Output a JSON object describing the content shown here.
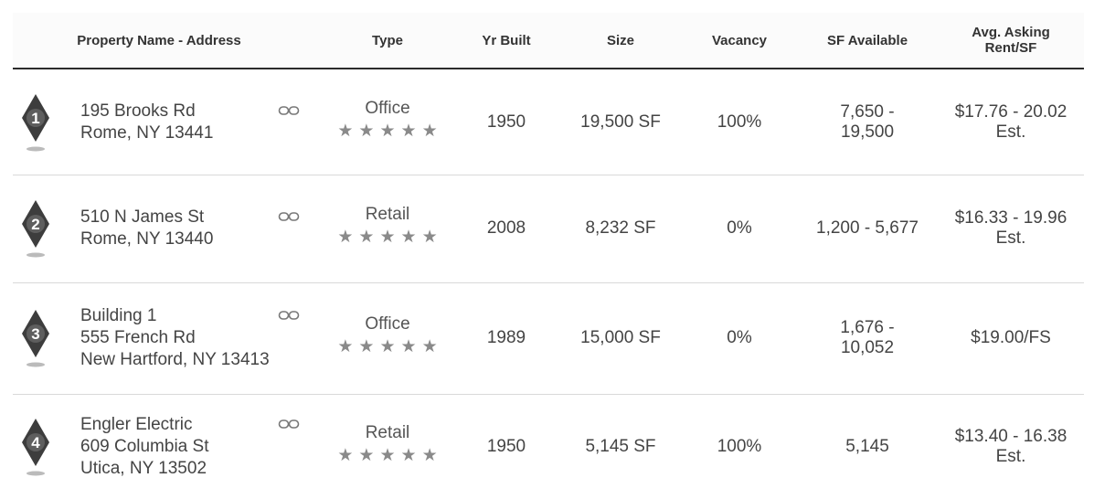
{
  "header": {
    "property": "Property Name - Address",
    "type": "Type",
    "yr_built": "Yr Built",
    "size": "Size",
    "vacancy": "Vacancy",
    "sf_available": "SF Available",
    "rent_line1": "Avg. Asking",
    "rent_line2": "Rent/SF"
  },
  "rows": [
    {
      "num": "1",
      "addr_lines": [
        "195 Brooks Rd",
        "Rome, NY 13441",
        ""
      ],
      "type": "Office",
      "stars": [
        "★",
        "★",
        "★",
        "★",
        "★"
      ],
      "yr_built": "1950",
      "size": "19,500 SF",
      "vacancy": "100%",
      "sf_available_1": "7,650 -",
      "sf_available_2": "19,500",
      "rent_1": "$17.76 - 20.02",
      "rent_2": "Est."
    },
    {
      "num": "2",
      "addr_lines": [
        "510 N James St",
        "Rome, NY 13440",
        ""
      ],
      "type": "Retail",
      "stars": [
        "★",
        "★",
        "★",
        "★",
        "★"
      ],
      "yr_built": "2008",
      "size": "8,232 SF",
      "vacancy": "0%",
      "sf_available_1": "1,200 - 5,677",
      "sf_available_2": "",
      "rent_1": "$16.33 - 19.96",
      "rent_2": "Est."
    },
    {
      "num": "3",
      "addr_lines": [
        "Building 1",
        "555 French Rd",
        "New Hartford, NY 13413"
      ],
      "type": "Office",
      "stars": [
        "★",
        "★",
        "★",
        "★",
        "★"
      ],
      "yr_built": "1989",
      "size": "15,000 SF",
      "vacancy": "0%",
      "sf_available_1": "1,676 -",
      "sf_available_2": "10,052",
      "rent_1": "$19.00/FS",
      "rent_2": ""
    },
    {
      "num": "4",
      "addr_lines": [
        "Engler Electric",
        "609 Columbia St",
        "Utica, NY 13502"
      ],
      "type": "Retail",
      "stars": [
        "★",
        "★",
        "★",
        "★",
        "★"
      ],
      "yr_built": "1950",
      "size": "5,145 SF",
      "vacancy": "100%",
      "sf_available_1": "5,145",
      "sf_available_2": "",
      "rent_1": "$13.40 - 16.38",
      "rent_2": "Est."
    }
  ],
  "colors": {
    "pin": "#3d3d3d",
    "header_rule": "#2b2b2b",
    "star": "#8a8a8a"
  },
  "icons": {
    "pin": "map-pin-icon",
    "link": "link-icon",
    "star": "star-icon"
  }
}
